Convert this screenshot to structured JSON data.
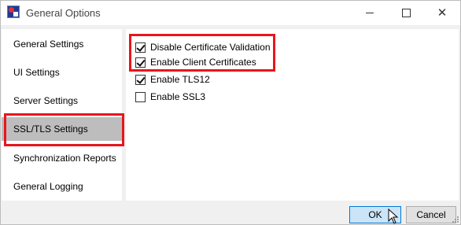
{
  "window": {
    "title": "General Options",
    "controls": {
      "minimize": "minimize",
      "maximize": "maximize",
      "close": "✕"
    }
  },
  "sidebar": {
    "items": [
      {
        "label": "General Settings"
      },
      {
        "label": "UI Settings"
      },
      {
        "label": "Server Settings"
      },
      {
        "label": "SSL/TLS Settings",
        "selected": true
      },
      {
        "label": "Synchronization Reports"
      },
      {
        "label": "General Logging"
      }
    ]
  },
  "options": [
    {
      "label": "Disable Certificate Validation",
      "checked": true
    },
    {
      "label": "Enable Client Certificates",
      "checked": true
    },
    {
      "label": "Enable TLS12",
      "checked": true
    },
    {
      "label": "Enable SSL3",
      "checked": false
    }
  ],
  "buttons": {
    "ok": "OK",
    "cancel": "Cancel"
  },
  "colors": {
    "highlight": "#e8151d",
    "selected_bg": "#bdbdbd",
    "ok_border": "#0078d7"
  }
}
